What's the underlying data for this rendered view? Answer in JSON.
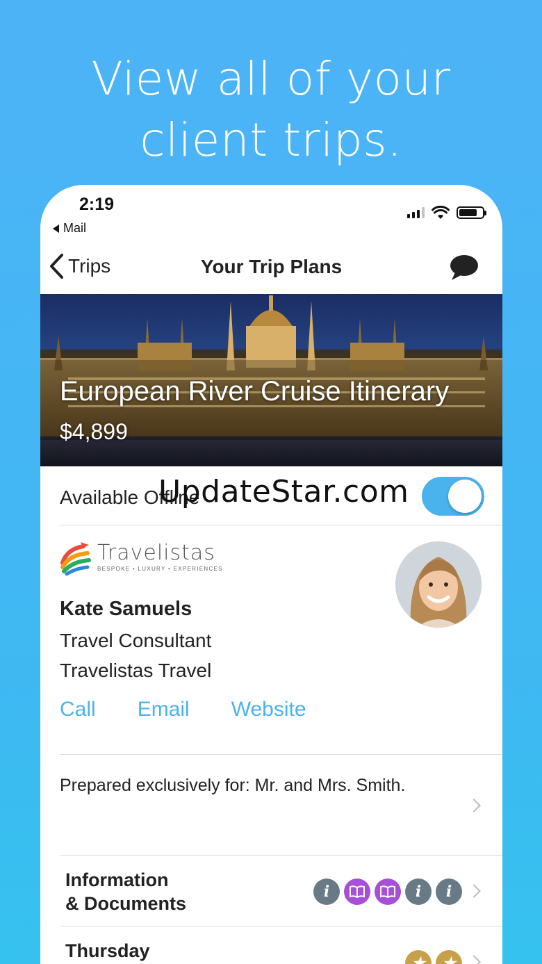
{
  "headline": {
    "line1": "View all of your",
    "line2": "client trips."
  },
  "status_bar": {
    "time": "2:19",
    "back_app": "Mail"
  },
  "nav": {
    "back_label": "Trips",
    "title": "Your Trip Plans"
  },
  "hero": {
    "title": "European River Cruise Itinerary",
    "price": "$4,899"
  },
  "offline": {
    "label": "Available Offline",
    "enabled": true
  },
  "watermark": "UpdateStar.com",
  "agent": {
    "brand_name": "Travelistas",
    "brand_tagline": "BESPOKE • LUXURY • EXPERIENCES",
    "name": "Kate Samuels",
    "role": "Travel Consultant",
    "company": "Travelistas Travel",
    "links": {
      "call": "Call",
      "email": "Email",
      "website": "Website"
    }
  },
  "prepared": {
    "text": "Prepared exclusively for: Mr. and Mrs. Smith."
  },
  "sections": [
    {
      "title_line1": "Information",
      "title_line2": "& Documents",
      "badges": [
        "info",
        "book",
        "book",
        "info",
        "info"
      ]
    },
    {
      "title_line1": "Thursday",
      "badges": [
        "gold",
        "gold"
      ]
    }
  ],
  "colors": {
    "accent": "#4ab3ee",
    "background": "#42b5f4",
    "info_badge": "#687a86",
    "book_badge": "#a74fd6",
    "gold_badge": "#c9a04a"
  }
}
